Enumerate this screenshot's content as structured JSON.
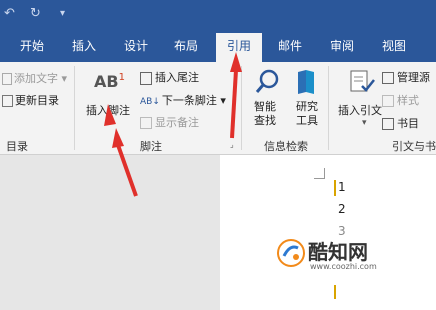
{
  "titlebar": {
    "undo_icon": "undo-icon",
    "redo_icon": "redo-icon",
    "customize_icon": "customize-quick-access-icon"
  },
  "tabs": [
    {
      "label": "开始"
    },
    {
      "label": "插入"
    },
    {
      "label": "设计"
    },
    {
      "label": "布局"
    },
    {
      "label": "引用",
      "active": true
    },
    {
      "label": "邮件"
    },
    {
      "label": "审阅"
    },
    {
      "label": "视图"
    }
  ],
  "ribbon": {
    "toc_group": {
      "add_text": "添加文字",
      "update_toc": "更新目录",
      "label": "目录"
    },
    "footnote_group": {
      "insert_footnote_big": "AB",
      "insert_footnote_sup": "1",
      "insert_footnote": "插入脚注",
      "insert_endnote": "插入尾注",
      "next_footnote": "下一条脚注",
      "show_notes": "显示备注",
      "label": "脚注"
    },
    "research_group": {
      "smart_lookup_line1": "智能",
      "smart_lookup_line2": "查找",
      "researcher_line1": "研究",
      "researcher_line2": "工具",
      "label": "信息检索"
    },
    "citation_group": {
      "insert_citation": "插入引文",
      "manage_sources": "管理源",
      "style": "样式",
      "bibliography": "书目",
      "label": "引文与书"
    }
  },
  "document": {
    "lines": [
      "1",
      "2",
      "3"
    ]
  },
  "watermark": {
    "brand": "酷知网",
    "url": "www.coozhi.com"
  },
  "colors": {
    "accent": "#2b579a",
    "arrow": "#e0302b"
  }
}
